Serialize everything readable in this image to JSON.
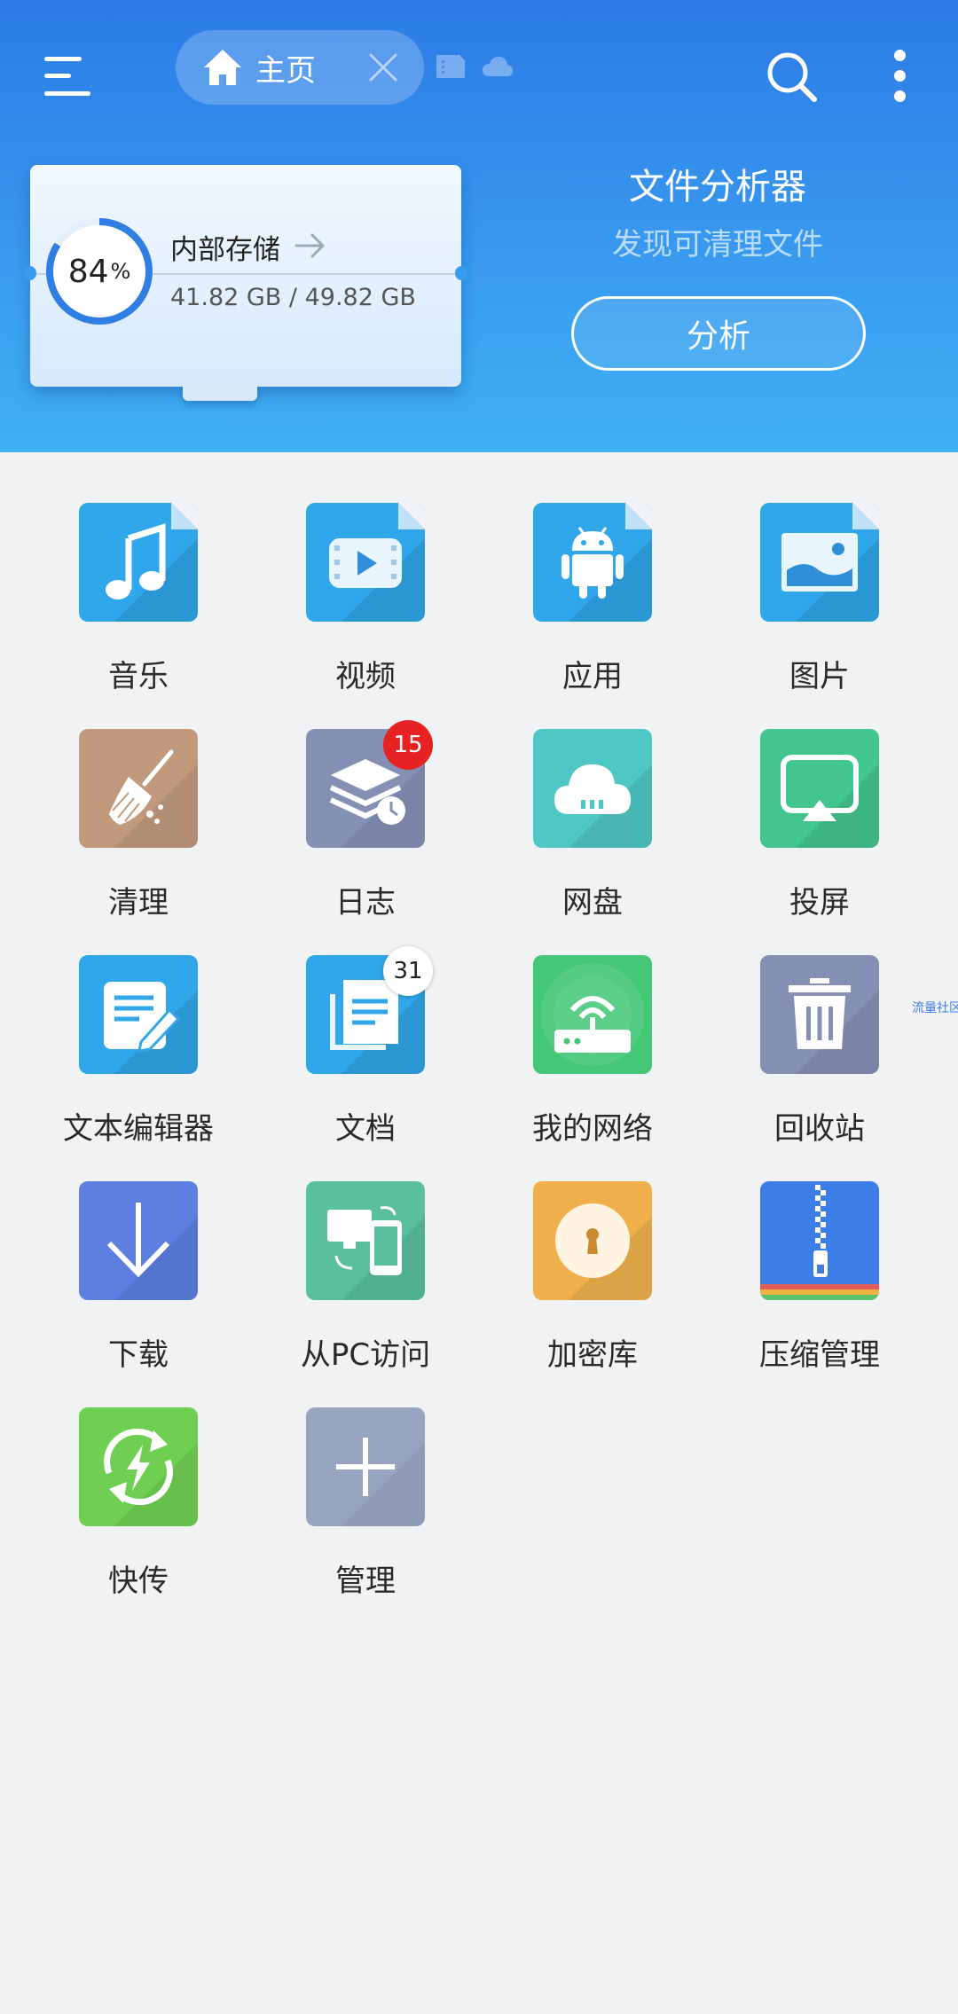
{
  "header": {
    "tab_label": "主页",
    "analyzer_title": "文件分析器",
    "analyzer_subtitle": "发现可清理文件",
    "analyze_button": "分析"
  },
  "storage": {
    "title": "内部存储",
    "percent": "84",
    "percent_sign": "%",
    "usage": "41.82 GB / 49.82 GB",
    "used_fraction": 0.84
  },
  "grid": {
    "items": [
      {
        "label": "音乐"
      },
      {
        "label": "视频"
      },
      {
        "label": "应用"
      },
      {
        "label": "图片"
      },
      {
        "label": "清理"
      },
      {
        "label": "日志",
        "badge": "15"
      },
      {
        "label": "网盘"
      },
      {
        "label": "投屏"
      },
      {
        "label": "文本编辑器"
      },
      {
        "label": "文档",
        "badge": "31"
      },
      {
        "label": "我的网络"
      },
      {
        "label": "回收站"
      },
      {
        "label": "下载"
      },
      {
        "label": "从PC访问"
      },
      {
        "label": "加密库"
      },
      {
        "label": "压缩管理"
      },
      {
        "label": "快传"
      },
      {
        "label": "管理"
      }
    ]
  },
  "side_tag": "流量社区",
  "colors": {
    "header_top": "#2c7ae6",
    "header_bottom": "#3eb0f5",
    "background": "#f1f2f4",
    "badge_red": "#e72222"
  },
  "icons": {
    "menu": "hamburger-icon",
    "home": "home-icon",
    "close": "close-icon",
    "search": "search-icon",
    "more": "more-vertical-icon"
  }
}
